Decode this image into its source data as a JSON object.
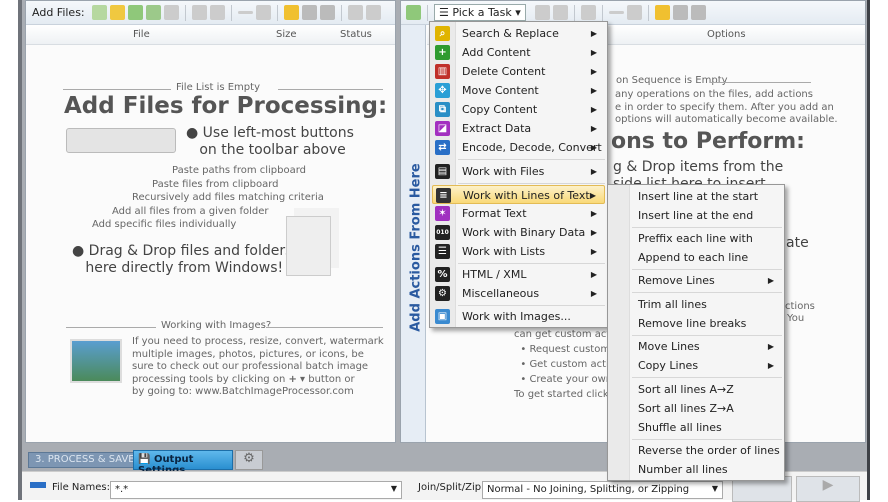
{
  "left_panel": {
    "add_files_label": "Add Files:",
    "columns": [
      "File",
      "Size",
      "Status"
    ],
    "empty_caption": "File List is Empty",
    "headline": "Add Files for Processing:",
    "bullet1_line1": "Use left-most buttons",
    "bullet1_line2": "on the toolbar above",
    "annotations": [
      "Paste paths from clipboard",
      "Paste files from clipboard",
      "Recursively add files matching criteria",
      "Add all files from a given folder",
      "Add specific files individually"
    ],
    "bullet2_line1": "Drag & Drop files and folders",
    "bullet2_line2": "here directly from Windows!",
    "images_caption": "Working with Images?",
    "images_text": [
      "If you need to process, resize, convert, watermark",
      "multiple images, photos, pictures, or icons, be",
      "sure to check out our professional batch image",
      "processing tools by clicking on",
      "button or",
      "by going to: www.BatchImageProcessor.com"
    ]
  },
  "right_panel": {
    "pick_task_label": "Pick a Task",
    "vertical_label": "Add Actions From Here",
    "options_header": "Options",
    "empty_caption": "on Sequence is Empty",
    "info_lines": [
      "any operations on the files, add actions",
      "e in order to specify them. After you add an",
      "options will automatically become available."
    ],
    "headline": "ons to Perform:",
    "drag_line1": "g & Drop items from the",
    "drag_line2": "side list here to insert",
    "partial_ate": "ate",
    "partial_ctions": "ctions",
    "partial_you": "You",
    "custom_intro": "can get custom actio",
    "custom_items": [
      "Request custom a",
      "Get custom actio",
      "Create your own"
    ],
    "get_started": "To get started click o"
  },
  "task_menu": {
    "items": [
      {
        "label": "Search & Replace",
        "icon": "search-icon",
        "color": "#e0b400"
      },
      {
        "label": "Add Content",
        "icon": "plus-icon",
        "color": "#2f9b2f"
      },
      {
        "label": "Delete Content",
        "icon": "trash-icon",
        "color": "#c0302a"
      },
      {
        "label": "Move Content",
        "icon": "move-icon",
        "color": "#2a9fd6"
      },
      {
        "label": "Copy Content",
        "icon": "copy-icon",
        "color": "#2a8fc6"
      },
      {
        "label": "Extract Data",
        "icon": "extract-icon",
        "color": "#a330c0"
      },
      {
        "label": "Encode, Decode, Convert",
        "icon": "convert-icon",
        "color": "#2a6fc6"
      },
      {
        "label": "Work with Files",
        "icon": "files-icon",
        "color": "#222222"
      },
      {
        "label": "Work with Lines of Text",
        "icon": "lines-icon",
        "color": "#333333"
      },
      {
        "label": "Format Text",
        "icon": "format-icon",
        "color": "#a030c0"
      },
      {
        "label": "Work with Binary Data",
        "icon": "binary-icon",
        "color": "#222222"
      },
      {
        "label": "Work with Lists",
        "icon": "list-icon",
        "color": "#222222"
      },
      {
        "label": "HTML / XML",
        "icon": "html-icon",
        "color": "#222222"
      },
      {
        "label": "Miscellaneous",
        "icon": "gear-icon",
        "color": "#222222"
      },
      {
        "label": "Work with Images...",
        "icon": "images-icon",
        "color": "#3a8ad0"
      }
    ]
  },
  "lines_submenu": {
    "items": [
      "Insert line at the start",
      "Insert line at the end",
      "Preffix each line with",
      "Append to each line",
      "Remove Lines",
      "Trim all lines",
      "Remove line breaks",
      "Move Lines",
      "Copy Lines",
      "Sort all lines A→Z",
      "Sort all lines Z→A",
      "Shuffle all lines",
      "Reverse the order of lines",
      "Number all lines"
    ]
  },
  "bottom": {
    "step_label": "3. PROCESS & SAVE",
    "tab_output": "Output Settings",
    "file_names_label": "File Names:",
    "file_names_value": "*.*",
    "join_label": "Join/Split/Zip:",
    "join_value": "Normal - No Joining, Splitting, or Zipping"
  }
}
